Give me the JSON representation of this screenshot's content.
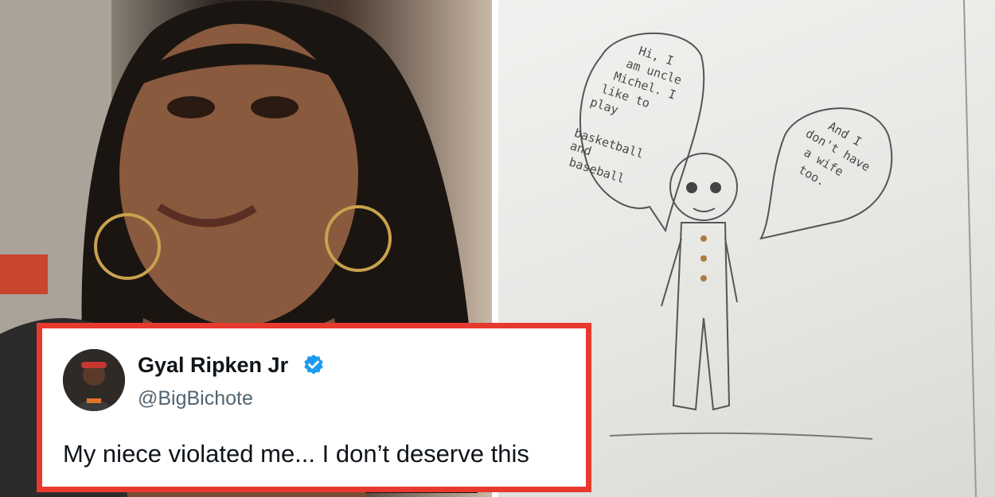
{
  "tweet": {
    "display_name": "Gyal Ripken Jr",
    "handle": "@BigBichote",
    "text": "My niece violated me... I don’t deserve this",
    "verified": true,
    "border_color": "#e8392e",
    "verified_color": "#1d9bf0"
  },
  "drawing": {
    "speech_left_lines": [
      "Hi, I",
      "am uncle",
      "Michel. I",
      "like to",
      "play",
      "basketball",
      "and",
      "baseball"
    ],
    "speech_right_lines": [
      "And I",
      "don't have",
      "a wife",
      "too."
    ]
  }
}
